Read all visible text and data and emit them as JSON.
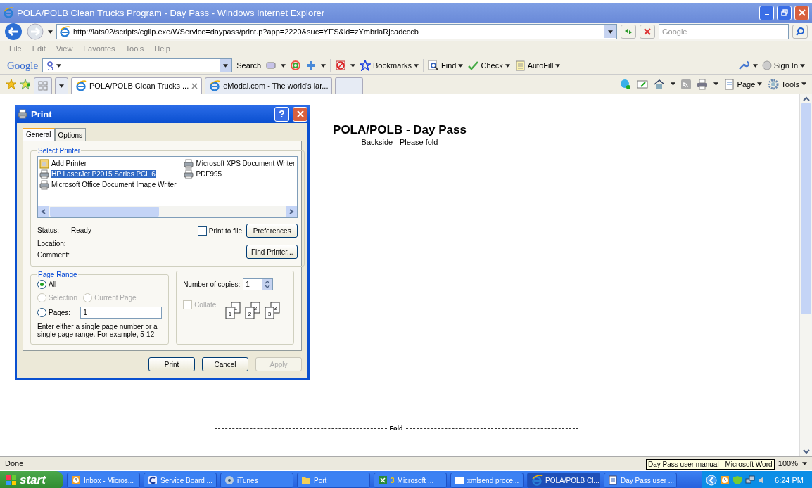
{
  "window": {
    "title": "POLA/POLB Clean Trucks Program - Day Pass - Windows Internet Explorer"
  },
  "address_bar": {
    "url": "http://lats02/scripts/cgiip.exe/WService=daypass/print.p?app=2220&suc=YES&id=zYmbriaRjcadcccb",
    "search_placeholder": "Google"
  },
  "menu": [
    "File",
    "Edit",
    "View",
    "Favorites",
    "Tools",
    "Help"
  ],
  "google_toolbar": {
    "logo": "Google",
    "search": "Search",
    "bookmarks": "Bookmarks",
    "find": "Find",
    "check": "Check",
    "autofill": "AutoFill",
    "sign_in": "Sign In"
  },
  "tabs": [
    {
      "label": "POLA/POLB Clean Trucks ...",
      "selected": true
    },
    {
      "label": "eModal.com - The world's lar...",
      "selected": false
    }
  ],
  "command_bar": {
    "page": "Page",
    "tools": "Tools"
  },
  "page": {
    "title": "POLA/POLB - Day Pass",
    "subtitle": "Backside - Please fold",
    "fold_label": "Fold"
  },
  "print_dialog": {
    "title": "Print",
    "help_label": "?",
    "tabs": [
      {
        "label": "General",
        "selected": true
      },
      {
        "label": "Options",
        "selected": false
      }
    ],
    "select_printer_label": "Select Printer",
    "printers": [
      {
        "name": "Add Printer",
        "kind": "add",
        "selected": false
      },
      {
        "name": "HP LaserJet P2015 Series PCL 6",
        "kind": "printer",
        "selected": true
      },
      {
        "name": "Microsoft Office Document Image Writer",
        "kind": "printer",
        "selected": false
      },
      {
        "name": "Microsoft XPS Document Writer",
        "kind": "printer",
        "selected": false
      },
      {
        "name": "PDF995",
        "kind": "printer",
        "selected": false
      }
    ],
    "status_label": "Status:",
    "status_value": "Ready",
    "location_label": "Location:",
    "comment_label": "Comment:",
    "print_to_file": {
      "label": "Print to file",
      "checked": false
    },
    "preferences_button": "Preferences",
    "find_printer_button": "Find Printer...",
    "page_range_label": "Page Range",
    "ranges": [
      {
        "label": "All",
        "selected": true,
        "disabled": false
      },
      {
        "label": "Selection",
        "selected": false,
        "disabled": true
      },
      {
        "label": "Current Page",
        "selected": false,
        "disabled": true
      },
      {
        "label": "Pages:",
        "selected": false,
        "disabled": false
      }
    ],
    "pages_value": "1",
    "hint": "Enter either a single page number or a single page range.  For example, 5-12",
    "copies_label": "Number of copies:",
    "copies_value": "1",
    "collate": {
      "label": "Collate",
      "checked": false,
      "disabled": true
    },
    "collate_stacks": [
      {
        "front": "1",
        "back": "1"
      },
      {
        "front": "2",
        "back": "2"
      },
      {
        "front": "3",
        "back": "3"
      }
    ],
    "buttons": [
      {
        "label": "Print",
        "disabled": false
      },
      {
        "label": "Cancel",
        "disabled": false
      },
      {
        "label": "Apply",
        "disabled": true
      }
    ]
  },
  "status_bar": {
    "text": "Done",
    "zoom": "100%"
  },
  "tooltip": "Day Pass user manual - Microsoft Word",
  "taskbar": {
    "start": "start",
    "clock": "6:24 PM",
    "items": [
      {
        "label": "Inbox - Micros...",
        "kind": "outlook",
        "selected": false
      },
      {
        "label": "Service Board ...",
        "kind": "app",
        "selected": false
      },
      {
        "label": "iTunes",
        "kind": "disc",
        "selected": false
      },
      {
        "label": "Port",
        "kind": "folder",
        "selected": false
      },
      {
        "label": "Microsoft ...",
        "count": "3",
        "kind": "excel",
        "selected": false
      },
      {
        "label": "xmlsend proce...",
        "kind": "window",
        "selected": false
      },
      {
        "label": "POLA/POLB Cl...",
        "kind": "ie",
        "selected": true
      },
      {
        "label": "Day Pass user ...",
        "kind": "word",
        "selected": false
      }
    ]
  }
}
